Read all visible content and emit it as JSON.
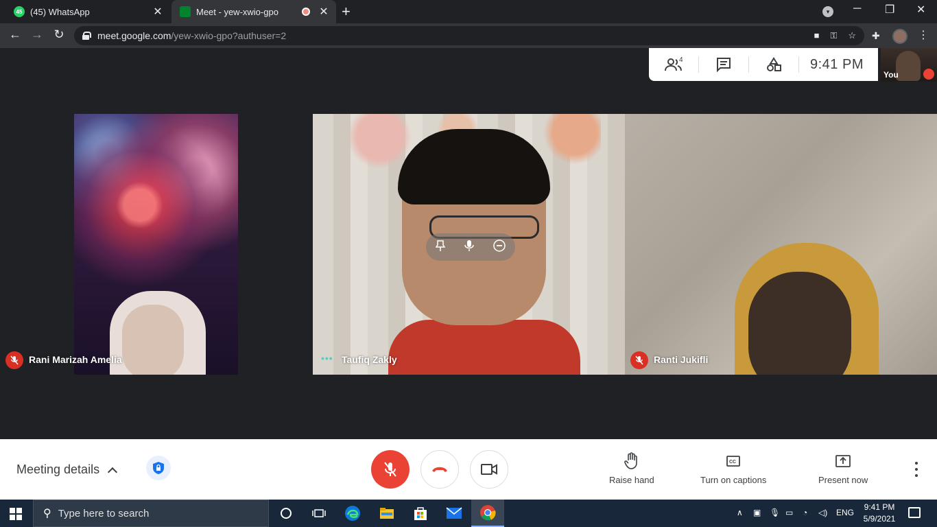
{
  "browser": {
    "tabs": [
      {
        "title": "(45) WhatsApp",
        "badge": "45",
        "active": false
      },
      {
        "title": "Meet - yew-xwio-gpo",
        "active": true,
        "recording": true
      }
    ],
    "url_host": "meet.google.com",
    "url_path": "/yew-xwio-gpo?authuser=2"
  },
  "meet": {
    "participants_count": "4",
    "time": "9:41  PM",
    "self_label": "You",
    "tiles": [
      {
        "name": "Rani Marizah Amelia",
        "muted": true
      },
      {
        "name": "Taufiq Zakly",
        "muted": false,
        "speaking": true
      },
      {
        "name": "Ranti Jukifli",
        "muted": true
      }
    ],
    "bottom_bar": {
      "meeting_details": "Meeting details",
      "raise_hand": "Raise hand",
      "captions": "Turn on captions",
      "present": "Present now"
    },
    "colors": {
      "accent_red": "#ea4335",
      "shield_blue": "#1a73e8"
    }
  },
  "taskbar": {
    "search_placeholder": "Type here to search",
    "language": "ENG",
    "time": "9:41 PM",
    "date": "5/9/2021"
  }
}
